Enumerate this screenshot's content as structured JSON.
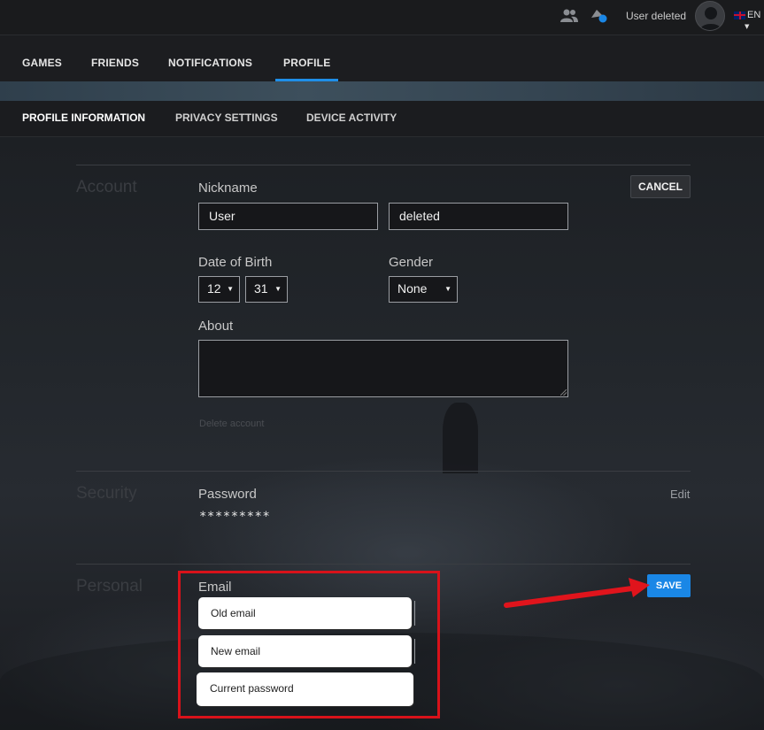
{
  "topbar": {
    "username": "User deleted",
    "language": "EN",
    "icons": [
      "friends-icon",
      "notification-icon",
      "avatar",
      "flag-uk-icon",
      "chevron-down-icon"
    ]
  },
  "main_nav": {
    "tabs": [
      {
        "label": "GAMES",
        "active": false
      },
      {
        "label": "FRIENDS",
        "active": false
      },
      {
        "label": "NOTIFICATIONS",
        "active": false
      },
      {
        "label": "PROFILE",
        "active": true
      }
    ]
  },
  "sub_nav": {
    "tabs": [
      {
        "label": "PROFILE INFORMATION",
        "active": true
      },
      {
        "label": "PRIVACY SETTINGS",
        "active": false
      },
      {
        "label": "DEVICE ACTIVITY",
        "active": false
      }
    ]
  },
  "account": {
    "section_title": "Account",
    "cancel_label": "CANCEL",
    "nickname_label": "Nickname",
    "first_name": "User",
    "last_name": "deleted",
    "dob_label": "Date of Birth",
    "dob_month": "12",
    "dob_day": "31",
    "gender_label": "Gender",
    "gender_value": "None",
    "about_label": "About",
    "about_value": "",
    "delete_account_label": "Delete account"
  },
  "security": {
    "section_title": "Security",
    "password_label": "Password",
    "password_value": "*********",
    "edit_label": "Edit"
  },
  "personal": {
    "section_title": "Personal",
    "email_label": "Email",
    "save_label": "SAVE",
    "old_email_placeholder": "Old email",
    "new_email_placeholder": "New email",
    "current_password_placeholder": "Current password"
  },
  "colors": {
    "accent": "#1a87e6",
    "highlight_box": "#d8121a",
    "arrow": "#e0141c"
  }
}
